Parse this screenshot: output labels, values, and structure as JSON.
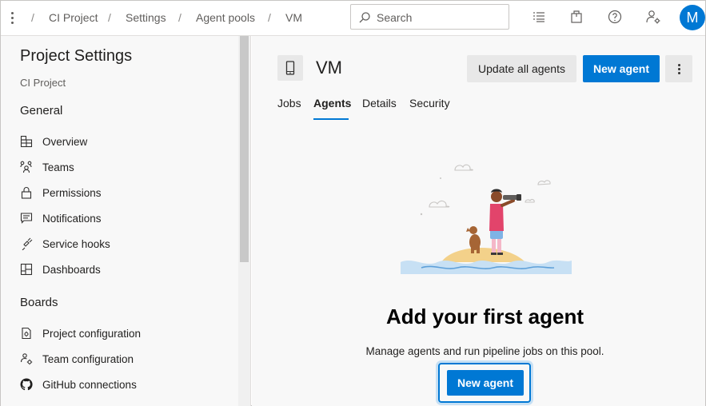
{
  "breadcrumb": {
    "items": [
      "CI Project",
      "Settings",
      "Agent pools",
      "VM"
    ],
    "separator": "/"
  },
  "search": {
    "placeholder": "Search"
  },
  "topbar_icons": [
    "list-icon",
    "shopping-bag-icon",
    "help-icon",
    "user-settings-icon"
  ],
  "user": {
    "initial": "M",
    "avatar_color": "#0078d4"
  },
  "sidebar": {
    "title": "Project Settings",
    "subtitle": "CI Project",
    "sections": [
      {
        "title": "General",
        "items": [
          {
            "label": "Overview",
            "icon": "overview-icon"
          },
          {
            "label": "Teams",
            "icon": "teams-icon"
          },
          {
            "label": "Permissions",
            "icon": "lock-icon"
          },
          {
            "label": "Notifications",
            "icon": "notifications-icon"
          },
          {
            "label": "Service hooks",
            "icon": "service-hooks-icon"
          },
          {
            "label": "Dashboards",
            "icon": "dashboards-icon"
          }
        ]
      },
      {
        "title": "Boards",
        "items": [
          {
            "label": "Project configuration",
            "icon": "project-config-icon"
          },
          {
            "label": "Team configuration",
            "icon": "team-config-icon"
          },
          {
            "label": "GitHub connections",
            "icon": "github-icon"
          }
        ]
      }
    ]
  },
  "main": {
    "title": "VM",
    "update_all_label": "Update all agents",
    "new_agent_label": "New agent",
    "tabs": [
      {
        "label": "Jobs",
        "selected": false
      },
      {
        "label": "Agents",
        "selected": true
      },
      {
        "label": "Details",
        "selected": false
      },
      {
        "label": "Security",
        "selected": false
      }
    ],
    "empty": {
      "title": "Add your first agent",
      "description": "Manage agents and run pipeline jobs on this pool.",
      "button_label": "New agent"
    }
  },
  "colors": {
    "accent": "#0078d4",
    "sidebar_bg": "#f8f8f8",
    "secondary_button": "#e8e8e8"
  }
}
